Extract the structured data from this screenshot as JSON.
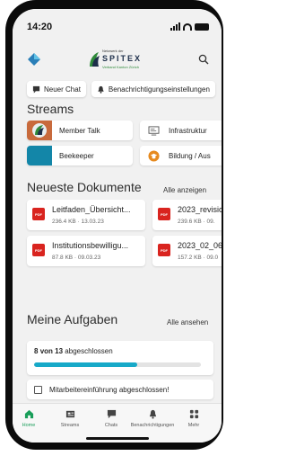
{
  "status": {
    "time": "14:20"
  },
  "brand": {
    "small": "Netzwerk der",
    "name": "SPITEX",
    "sub": "Verband Kanton Zürich"
  },
  "colors": {
    "accent": "#1a9e5a",
    "progress": "#17a9c8",
    "pdf": "#d9241f"
  },
  "chips": [
    {
      "label": "Neuer Chat",
      "icon": "chat-icon"
    },
    {
      "label": "Benachrichtigungseinstellungen",
      "icon": "bell-icon"
    }
  ],
  "streams": {
    "title": "Streams",
    "items": [
      {
        "label": "Member Talk",
        "icon": "member-talk-thumbnail"
      },
      {
        "label": "Infrastruktur",
        "icon": "infrastructure-icon"
      },
      {
        "label": "Beekeeper",
        "icon": "beekeeper-thumbnail"
      },
      {
        "label": "Bildung / Aus",
        "icon": "graduation-cap-icon"
      }
    ]
  },
  "documents": {
    "title": "Neueste Dokumente",
    "link": "Alle anzeigen",
    "items": [
      {
        "name": "Leitfaden_Übersicht...",
        "meta": "236.4 KB · 13.03.23"
      },
      {
        "name": "2023_revisic",
        "meta": "239.6 KB · 09."
      },
      {
        "name": "Institutionsbewilligu...",
        "meta": "87.8 KB · 09.03.23"
      },
      {
        "name": "2023_02_06",
        "meta": "157.2 KB · 09.0"
      }
    ],
    "pdf_label": "PDF"
  },
  "tasks": {
    "title": "Meine Aufgaben",
    "link": "Alle ansehen",
    "done": "8",
    "of": "von",
    "total": "13",
    "suffix": "abgeschlossen",
    "progress": 0.62,
    "items": [
      {
        "label": "Mitarbeitereinführung abgeschlossen!",
        "checked": false
      }
    ]
  },
  "tabbar": [
    {
      "label": "Home",
      "icon": "home-icon",
      "active": true
    },
    {
      "label": "Streams",
      "icon": "streams-icon",
      "active": false
    },
    {
      "label": "Chats",
      "icon": "chats-icon",
      "active": false
    },
    {
      "label": "Benachrichtigungen",
      "icon": "bell-icon",
      "active": false
    },
    {
      "label": "Mehr",
      "icon": "grid-icon",
      "active": false
    }
  ]
}
